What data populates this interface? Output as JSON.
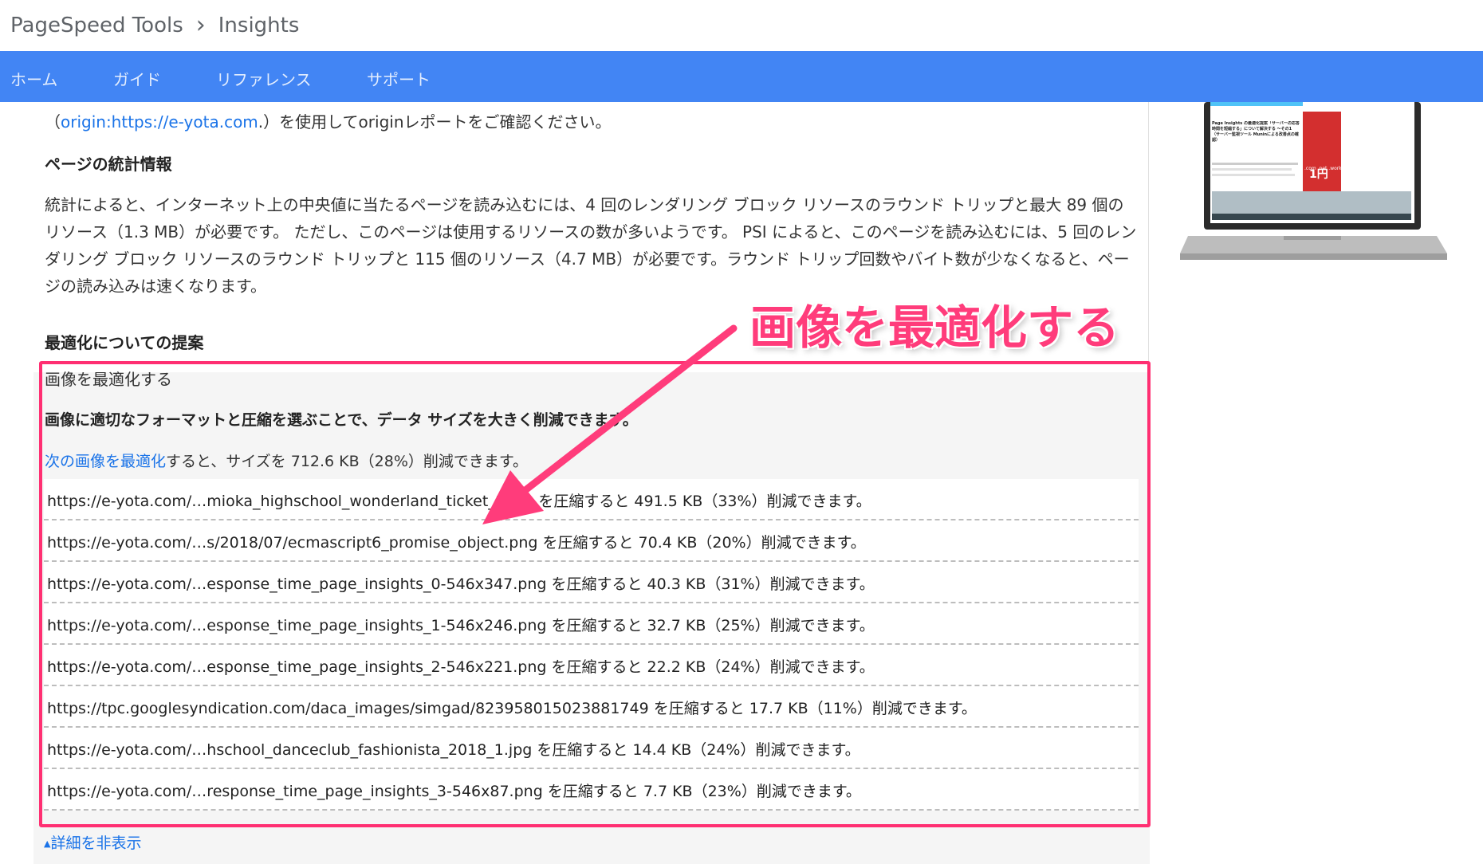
{
  "breadcrumb": {
    "root": "PageSpeed Tools",
    "separator": "›",
    "current": "Insights"
  },
  "nav": {
    "items": [
      "ホーム",
      "ガイド",
      "リファレンス",
      "サポート"
    ]
  },
  "origin_line": {
    "prefix": "（",
    "link": "origin:https://e-yota.com",
    "suffix": ".）を使用してoriginレポートをご確認ください。"
  },
  "stats": {
    "heading": "ページの統計情報",
    "body": "統計によると、インターネット上の中央値に当たるページを読み込むには、4 回のレンダリング ブロック リソースのラウンド トリップと最大 89 個のリソース（1.3 MB）が必要です。 ただし、このページは使用するリソースの数が多いようです。 PSI によると、このページを読み込むには、5 回のレンダリング ブロック リソースのラウンド トリップと 115 個のリソース（4.7 MB）が必要です。ラウンド トリップ回数やバイト数が少なくなると、ページの読み込みは速くなります。"
  },
  "optimization": {
    "heading": "最適化についての提案",
    "rule_title": "画像を最適化する",
    "rule_description": "画像に適切なフォーマットと圧縮を選ぶことで、データ サイズを大きく削減できます。",
    "summary_link": "次の画像を最適化",
    "summary_text": "すると、サイズを 712.6 KB（28%）削減できます。",
    "items": [
      "https://e-yota.com/…mioka_highschool_wonderland_ticket_2.jpg を圧縮すると 491.5 KB（33%）削減できます。",
      "https://e-yota.com/…s/2018/07/ecmascript6_promise_object.png を圧縮すると 70.4 KB（20%）削減できます。",
      "https://e-yota.com/…esponse_time_page_insights_0-546x347.png を圧縮すると 40.3 KB（31%）削減できます。",
      "https://e-yota.com/…esponse_time_page_insights_1-546x246.png を圧縮すると 32.7 KB（25%）削減できます。",
      "https://e-yota.com/…esponse_time_page_insights_2-546x221.png を圧縮すると 22.2 KB（24%）削減できます。",
      "https://tpc.googlesyndication.com/daca_images/simgad/823958015023881749 を圧縮すると 17.7 KB（11%）削減できます。",
      "https://e-yota.com/…hschool_danceclub_fashionista_2018_1.jpg を圧縮すると 14.4 KB（24%）削減できます。",
      "https://e-yota.com/…response_time_page_insights_3-546x87.png を圧縮すると 7.7 KB（23%）削減できます。"
    ],
    "toggle": "詳細を非表示"
  },
  "annotation": {
    "callout": "画像を最適化する",
    "color": "#ff3c7b"
  },
  "preview": {
    "headline": "Page Insights の最適化提案「サーバーの応答時間を短縮する」について解決する ～その1（サーバー監視ツール Muninによる改善点の確認）",
    "ad_price": "1円",
    "ad_domains": ".com .net .work"
  },
  "colors": {
    "nav_bar": "#4285f4",
    "link": "#1a73e8",
    "highlight": "#ff2f72"
  }
}
